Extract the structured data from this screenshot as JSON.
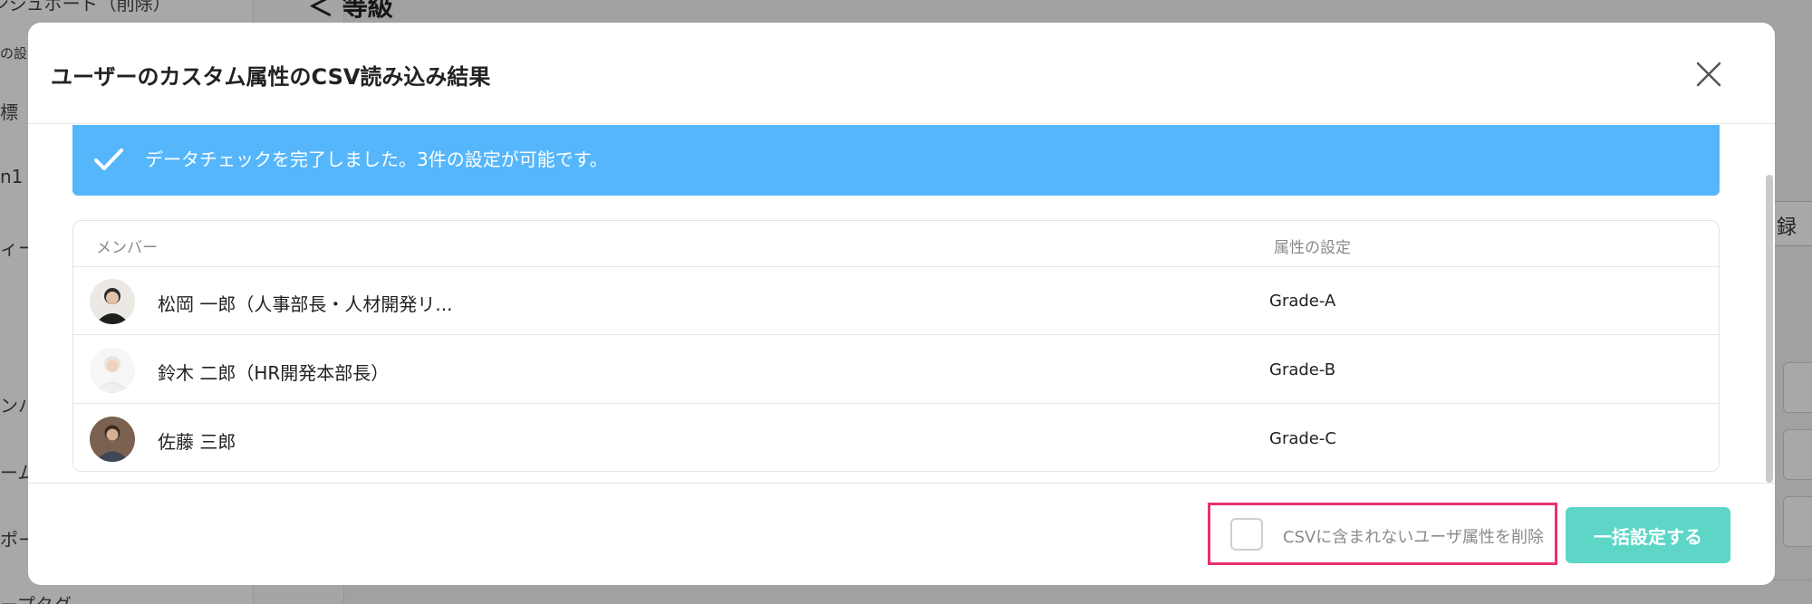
{
  "background": {
    "heading": "＜ 等級",
    "sidebar_items": [
      "ンジュボード（削除）",
      "の設",
      "標",
      "n1",
      "ィー",
      "ンバ",
      "ーム",
      "ポー",
      "ープタグ"
    ],
    "right_button": "録"
  },
  "modal": {
    "title": "ユーザーのカスタム属性のCSV読み込み結果",
    "close_icon": "close-icon"
  },
  "banner": {
    "icon": "check-icon",
    "text": "データチェックを完了しました。3件の設定が可能です。",
    "color": "#56b6fb"
  },
  "table": {
    "columns": {
      "member": "メンバー",
      "attribute": "属性の設定"
    },
    "rows": [
      {
        "name": "松岡 一郎（人事部長・人材開発リ...",
        "grade": "Grade-A"
      },
      {
        "name": "鈴木 二郎（HR開発本部長）",
        "grade": "Grade-B"
      },
      {
        "name": "佐藤 三郎",
        "grade": "Grade-C"
      }
    ]
  },
  "footer": {
    "checkbox_label": "CSVに含まれないユーザ属性を削除",
    "checkbox_checked": false,
    "submit_label": "一括設定する",
    "highlight_color": "#e8326f",
    "submit_color": "#5dd6c8"
  }
}
